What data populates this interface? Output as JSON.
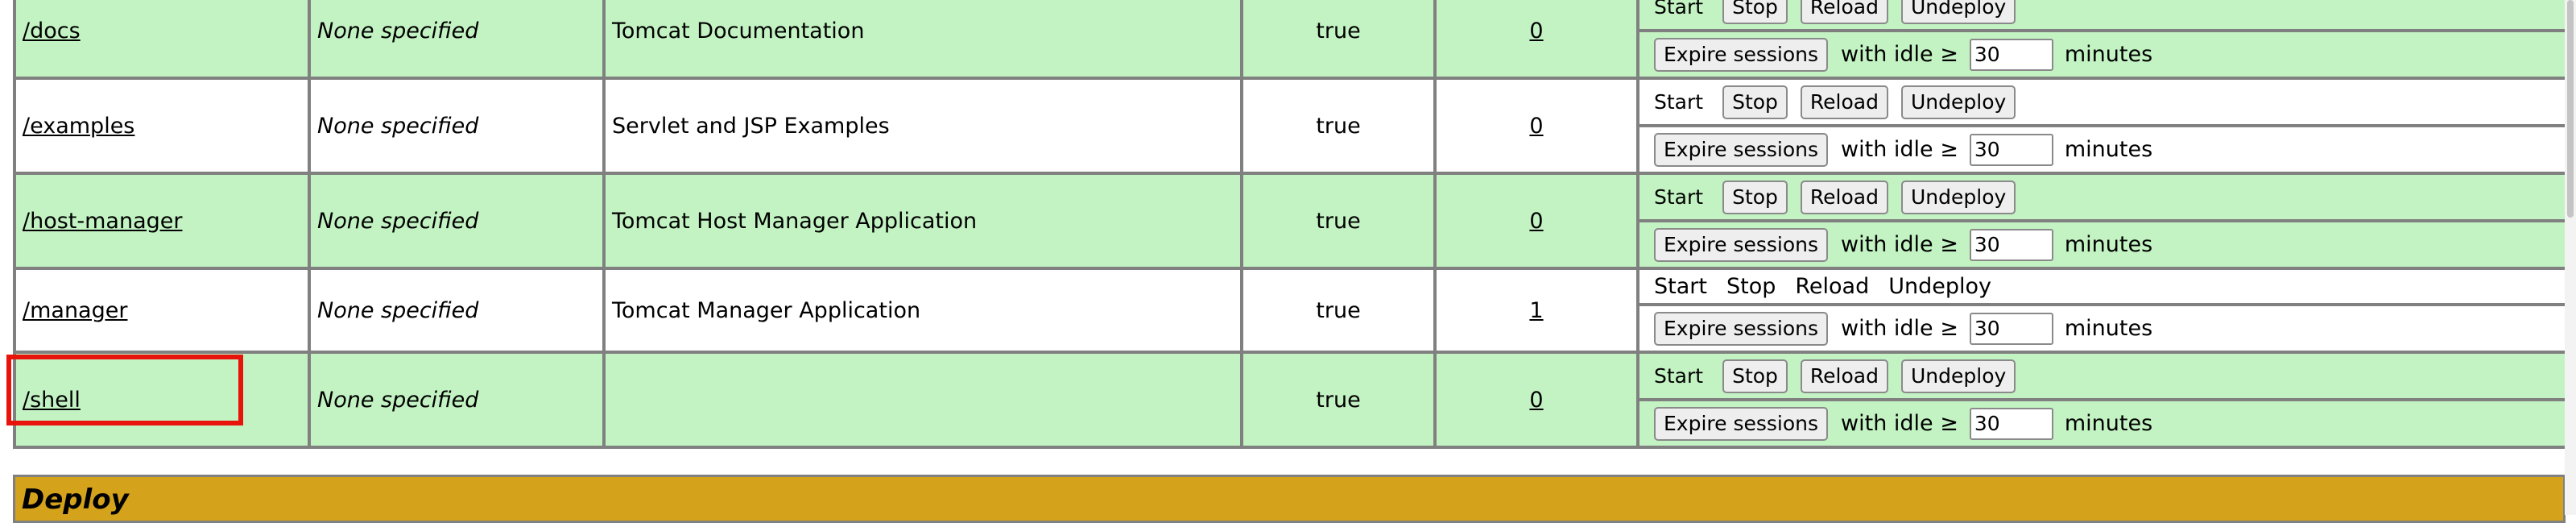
{
  "apps": [
    {
      "path": "/docs",
      "version": "None specified",
      "display_name": "Tomcat Documentation",
      "running": "true",
      "sessions": "0",
      "controls": "buttons",
      "color": "g"
    },
    {
      "path": "/examples",
      "version": "None specified",
      "display_name": "Servlet and JSP Examples",
      "running": "true",
      "sessions": "0",
      "controls": "buttons",
      "color": "w"
    },
    {
      "path": "/host-manager",
      "version": "None specified",
      "display_name": "Tomcat Host Manager Application",
      "running": "true",
      "sessions": "0",
      "controls": "buttons",
      "color": "g"
    },
    {
      "path": "/manager",
      "version": "None specified",
      "display_name": "Tomcat Manager Application",
      "running": "true",
      "sessions": "1",
      "controls": "text",
      "color": "w"
    },
    {
      "path": "/shell",
      "version": "None specified",
      "display_name": "",
      "running": "true",
      "sessions": "0",
      "controls": "buttons",
      "color": "g"
    }
  ],
  "commands": {
    "start": "Start",
    "stop": "Stop",
    "reload": "Reload",
    "undeploy": "Undeploy",
    "expire": "Expire sessions",
    "with_idle": "with idle ≥",
    "idle_value": "30",
    "minutes": "minutes"
  },
  "deploy": {
    "title": "Deploy"
  },
  "colors": {
    "green_row": "#c3f3c3",
    "header_gold": "#d4a21b",
    "highlight": "#e8140c"
  }
}
